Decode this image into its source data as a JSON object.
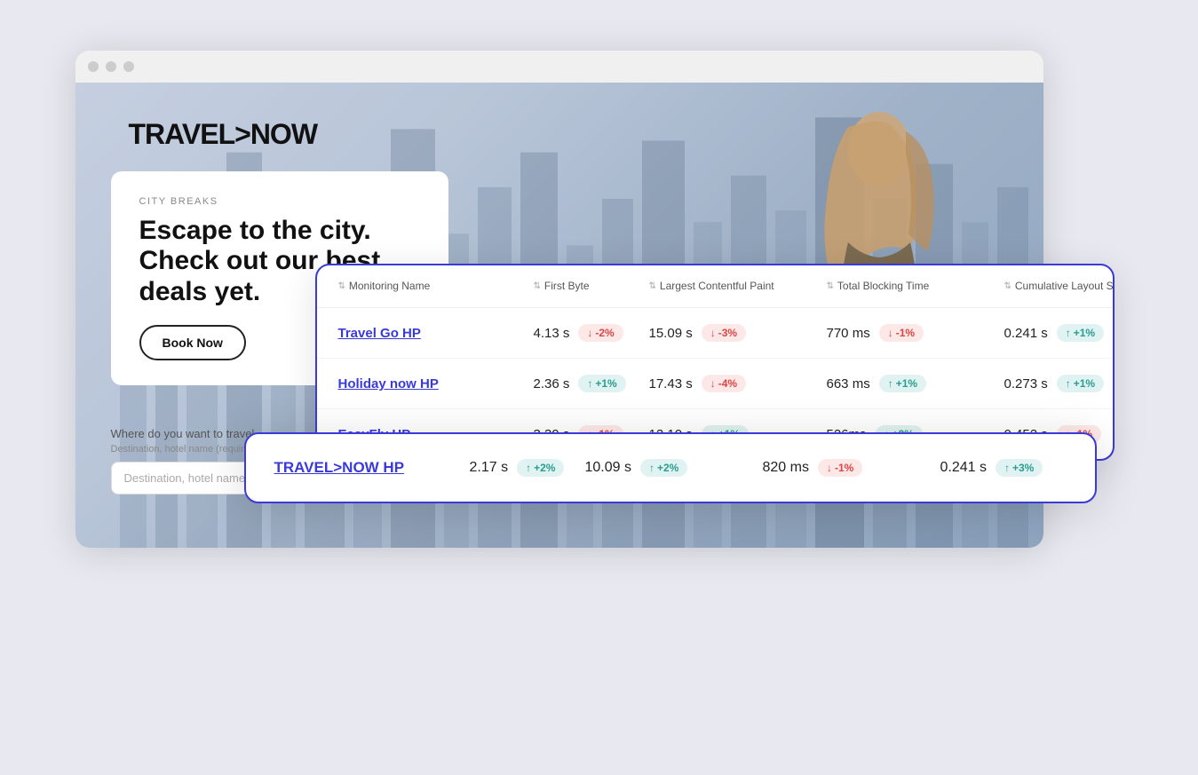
{
  "browser": {
    "dots": [
      "dot1",
      "dot2",
      "dot3"
    ]
  },
  "hero": {
    "logo": "TRAVEL>NOW",
    "category": "CITY BREAKS",
    "heading": "Escape to the city. Check out our best deals yet.",
    "book_button": "Book Now",
    "search_label": "Where do you want to travel",
    "search_sublabel": "Destination, hotel name (required field)",
    "search_placeholder": "Destination, hotel name"
  },
  "table": {
    "columns": [
      {
        "label": "Monitoring Name",
        "sort": true
      },
      {
        "label": "First Byte",
        "sort": true
      },
      {
        "label": "Largest Contentful Paint",
        "sort": true
      },
      {
        "label": "Total Blocking Time",
        "sort": true
      },
      {
        "label": "Cumulative Layout Shift",
        "sort": true
      }
    ],
    "rows": [
      {
        "name": "Travel Go HP",
        "first_byte": "4.13 s",
        "first_byte_badge": "-2%",
        "first_byte_badge_type": "red",
        "lcp": "15.09 s",
        "lcp_badge": "-3%",
        "lcp_badge_type": "red",
        "tbt": "770 ms",
        "tbt_badge": "-1%",
        "tbt_badge_type": "red",
        "cls": "0.241 s",
        "cls_badge": "+1%",
        "cls_badge_type": "green"
      },
      {
        "name": "Holiday now HP",
        "first_byte": "2.36 s",
        "first_byte_badge": "+1%",
        "first_byte_badge_type": "green",
        "lcp": "17.43 s",
        "lcp_badge": "-4%",
        "lcp_badge_type": "red",
        "tbt": "663 ms",
        "tbt_badge": "+1%",
        "tbt_badge_type": "green",
        "cls": "0.273 s",
        "cls_badge": "+1%",
        "cls_badge_type": "green"
      },
      {
        "name": "EasyFly HP",
        "first_byte": "3.39 s",
        "first_byte_badge": "-1%",
        "first_byte_badge_type": "red",
        "lcp": "12.10 s",
        "lcp_badge": "+1%",
        "lcp_badge_type": "green",
        "tbt": "526ms",
        "tbt_badge": "+2%",
        "tbt_badge_type": "green",
        "cls": "0.452 s",
        "cls_badge": "-1%",
        "cls_badge_type": "red"
      }
    ],
    "highlight_row": {
      "name": "TRAVEL>NOW HP",
      "first_byte": "2.17 s",
      "first_byte_badge": "+2%",
      "first_byte_badge_type": "green",
      "lcp": "10.09 s",
      "lcp_badge": "+2%",
      "lcp_badge_type": "green",
      "tbt": "820 ms",
      "tbt_badge": "-1%",
      "tbt_badge_type": "red",
      "cls": "0.241 s",
      "cls_badge": "+3%",
      "cls_badge_type": "green"
    }
  }
}
